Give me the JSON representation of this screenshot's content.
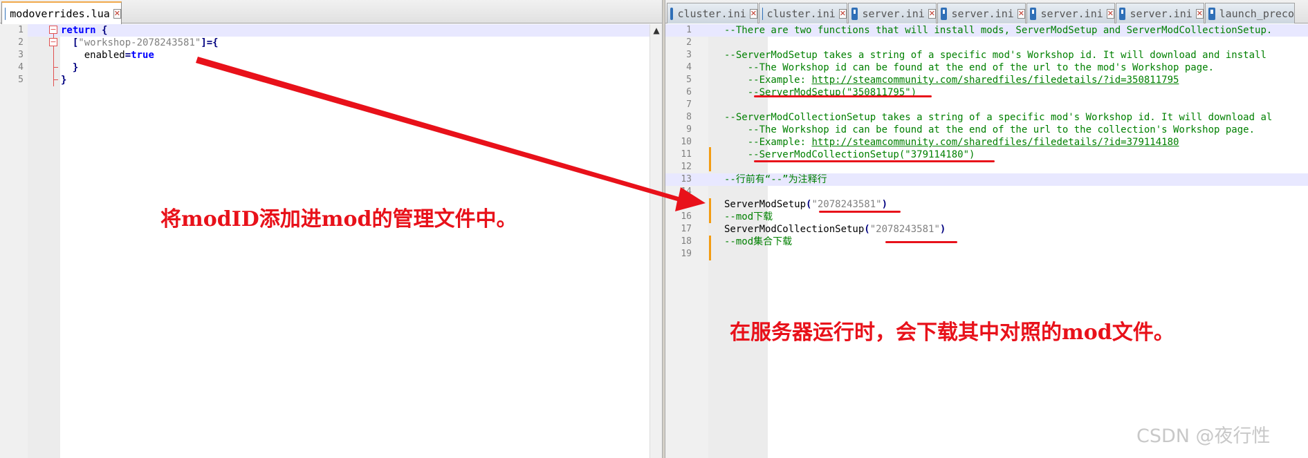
{
  "left_editor": {
    "tabs": [
      {
        "label": "modoverrides.lua"
      }
    ],
    "lines": [
      {
        "n": "1",
        "tokens": [
          {
            "t": "return",
            "c": "kw"
          },
          {
            "t": " {",
            "c": "op"
          }
        ]
      },
      {
        "n": "2",
        "tokens": [
          {
            "t": "  [",
            "c": "op"
          },
          {
            "t": "\"workshop-2078243581\"",
            "c": "str"
          },
          {
            "t": "]={",
            "c": "op"
          }
        ]
      },
      {
        "n": "3",
        "tokens": [
          {
            "t": "    enabled",
            "c": "tx"
          },
          {
            "t": "=",
            "c": "op"
          },
          {
            "t": "true",
            "c": "kw"
          }
        ]
      },
      {
        "n": "4",
        "tokens": [
          {
            "t": "  }",
            "c": "op"
          }
        ]
      },
      {
        "n": "5",
        "tokens": [
          {
            "t": "}",
            "c": "op"
          }
        ]
      }
    ]
  },
  "right_editor": {
    "tabs": [
      {
        "label": "cluster.ini"
      },
      {
        "label": "cluster.ini"
      },
      {
        "label": "server.ini"
      },
      {
        "label": "server.ini"
      },
      {
        "label": "server.ini"
      },
      {
        "label": "server.ini"
      },
      {
        "label": "launch_preco"
      }
    ],
    "lines": [
      {
        "n": "1",
        "tokens": [
          {
            "t": "--There are two functions that will install mods, ServerModSetup and ServerModCollectionSetup.",
            "c": "cm"
          }
        ]
      },
      {
        "n": "2",
        "tokens": []
      },
      {
        "n": "3",
        "tokens": [
          {
            "t": "--ServerModSetup takes a string of a specific mod's Workshop id. It will download and install",
            "c": "cm"
          }
        ]
      },
      {
        "n": "4",
        "tokens": [
          {
            "t": "    --The Workshop id can be found at the end of the url to the mod's Workshop page.",
            "c": "cm"
          }
        ]
      },
      {
        "n": "5",
        "tokens": [
          {
            "t": "    --Example: ",
            "c": "cm"
          },
          {
            "t": "http://steamcommunity.com/sharedfiles/filedetails/?id=350811795",
            "c": "url"
          }
        ]
      },
      {
        "n": "6",
        "tokens": [
          {
            "t": "    --ServerModSetup(\"350811795\")",
            "c": "cm"
          }
        ]
      },
      {
        "n": "7",
        "tokens": []
      },
      {
        "n": "8",
        "tokens": [
          {
            "t": "--ServerModCollectionSetup takes a string of a specific mod's Workshop id. It will download al",
            "c": "cm"
          }
        ]
      },
      {
        "n": "9",
        "tokens": [
          {
            "t": "    --The Workshop id can be found at the end of the url to the collection's Workshop page.",
            "c": "cm"
          }
        ]
      },
      {
        "n": "10",
        "tokens": [
          {
            "t": "    --Example: ",
            "c": "cm"
          },
          {
            "t": "http://steamcommunity.com/sharedfiles/filedetails/?id=379114180",
            "c": "url"
          }
        ]
      },
      {
        "n": "11",
        "tokens": [
          {
            "t": "    --ServerModCollectionSetup(\"379114180\")",
            "c": "cm"
          }
        ]
      },
      {
        "n": "12",
        "tokens": []
      },
      {
        "n": "13",
        "tokens": [
          {
            "t": "--行前有“--”为注释行",
            "c": "cm"
          }
        ]
      },
      {
        "n": "14",
        "tokens": []
      },
      {
        "n": "15",
        "tokens": [
          {
            "t": "ServerModSetup",
            "c": "fn"
          },
          {
            "t": "(",
            "c": "op"
          },
          {
            "t": "\"2078243581\"",
            "c": "str"
          },
          {
            "t": ")",
            "c": "op"
          }
        ]
      },
      {
        "n": "16",
        "tokens": [
          {
            "t": "--mod下载",
            "c": "cm"
          }
        ]
      },
      {
        "n": "17",
        "tokens": [
          {
            "t": "ServerModCollectionSetup",
            "c": "fn"
          },
          {
            "t": "(",
            "c": "op"
          },
          {
            "t": "\"2078243581\"",
            "c": "str"
          },
          {
            "t": ")",
            "c": "op"
          }
        ]
      },
      {
        "n": "18",
        "tokens": [
          {
            "t": "--mod集合下载",
            "c": "cm"
          }
        ]
      },
      {
        "n": "19",
        "tokens": []
      }
    ]
  },
  "annotations": {
    "left_note": "将modID添加进mod的管理文件中。",
    "right_note": "在服务器运行时，会下载其中对照的mod文件。",
    "watermark": "CSDN @夜行性"
  },
  "colors": {
    "annotation_red": "#e8111a",
    "comment_green": "#008000",
    "keyword_blue": "#0000ff",
    "string_gray": "#808080",
    "change_marker": "#f39c12"
  }
}
